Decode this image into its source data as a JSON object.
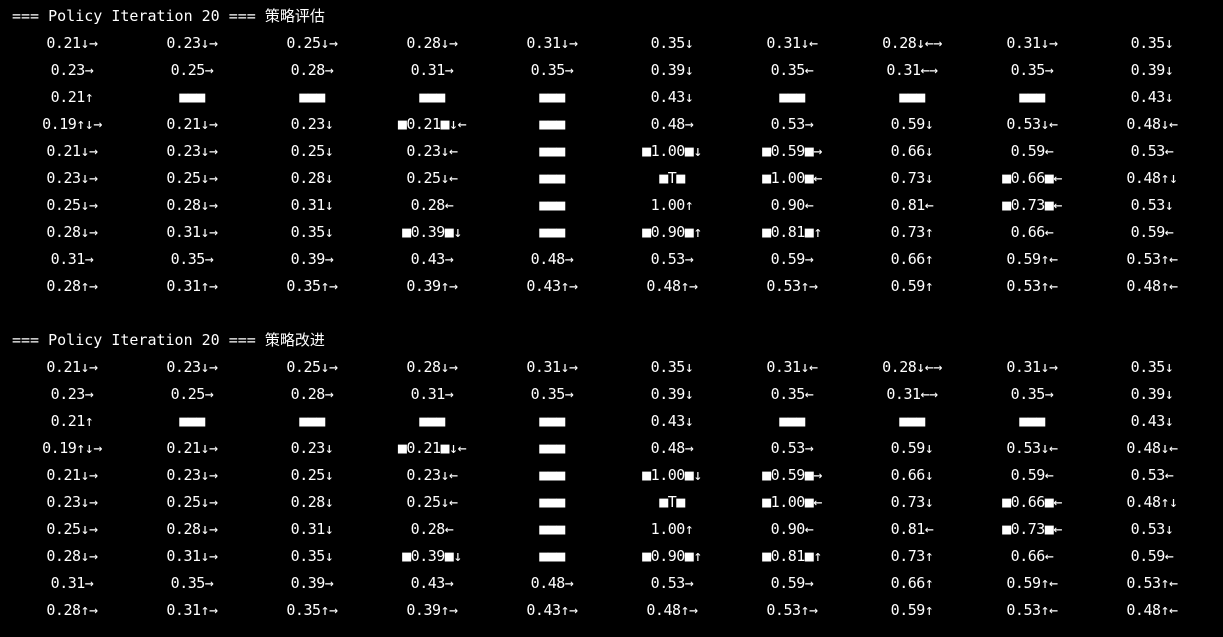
{
  "colors": {
    "background": "#000000",
    "foreground": "#ffffff"
  },
  "sections": [
    {
      "title": "=== Policy Iteration 20 === 策略评估",
      "rows": [
        [
          "0.21↓→",
          "0.23↓→",
          "0.25↓→",
          "0.28↓→",
          "0.31↓→",
          "0.35↓",
          "0.31↓←",
          "0.28↓←→",
          "0.31↓→",
          "0.35↓"
        ],
        [
          "0.23→",
          "0.25→",
          "0.28→",
          "0.31→",
          "0.35→",
          "0.39↓",
          "0.35←",
          "0.31←→",
          "0.35→",
          "0.39↓"
        ],
        [
          "0.21↑",
          "■■■",
          "■■■",
          "■■■",
          "■■■",
          "0.43↓",
          "■■■",
          "■■■",
          "■■■",
          "0.43↓"
        ],
        [
          "0.19↑↓→",
          "0.21↓→",
          "0.23↓",
          "■0.21■↓←",
          "■■■",
          "0.48→",
          "0.53→",
          "0.59↓",
          "0.53↓←",
          "0.48↓←"
        ],
        [
          "0.21↓→",
          "0.23↓→",
          "0.25↓",
          "0.23↓←",
          "■■■",
          "■1.00■↓",
          "■0.59■→",
          "0.66↓",
          "0.59←",
          "0.53←"
        ],
        [
          "0.23↓→",
          "0.25↓→",
          "0.28↓",
          "0.25↓←",
          "■■■",
          "■T■",
          "■1.00■←",
          "0.73↓",
          "■0.66■←",
          "0.48↑↓"
        ],
        [
          "0.25↓→",
          "0.28↓→",
          "0.31↓",
          "0.28←",
          "■■■",
          "1.00↑",
          "0.90←",
          "0.81←",
          "■0.73■←",
          "0.53↓"
        ],
        [
          "0.28↓→",
          "0.31↓→",
          "0.35↓",
          "■0.39■↓",
          "■■■",
          "■0.90■↑",
          "■0.81■↑",
          "0.73↑",
          "0.66←",
          "0.59←"
        ],
        [
          "0.31→",
          "0.35→",
          "0.39→",
          "0.43→",
          "0.48→",
          "0.53→",
          "0.59→",
          "0.66↑",
          "0.59↑←",
          "0.53↑←"
        ],
        [
          "0.28↑→",
          "0.31↑→",
          "0.35↑→",
          "0.39↑→",
          "0.43↑→",
          "0.48↑→",
          "0.53↑→",
          "0.59↑",
          "0.53↑←",
          "0.48↑←"
        ]
      ]
    },
    {
      "title": "=== Policy Iteration 20 === 策略改进",
      "rows": [
        [
          "0.21↓→",
          "0.23↓→",
          "0.25↓→",
          "0.28↓→",
          "0.31↓→",
          "0.35↓",
          "0.31↓←",
          "0.28↓←→",
          "0.31↓→",
          "0.35↓"
        ],
        [
          "0.23→",
          "0.25→",
          "0.28→",
          "0.31→",
          "0.35→",
          "0.39↓",
          "0.35←",
          "0.31←→",
          "0.35→",
          "0.39↓"
        ],
        [
          "0.21↑",
          "■■■",
          "■■■",
          "■■■",
          "■■■",
          "0.43↓",
          "■■■",
          "■■■",
          "■■■",
          "0.43↓"
        ],
        [
          "0.19↑↓→",
          "0.21↓→",
          "0.23↓",
          "■0.21■↓←",
          "■■■",
          "0.48→",
          "0.53→",
          "0.59↓",
          "0.53↓←",
          "0.48↓←"
        ],
        [
          "0.21↓→",
          "0.23↓→",
          "0.25↓",
          "0.23↓←",
          "■■■",
          "■1.00■↓",
          "■0.59■→",
          "0.66↓",
          "0.59←",
          "0.53←"
        ],
        [
          "0.23↓→",
          "0.25↓→",
          "0.28↓",
          "0.25↓←",
          "■■■",
          "■T■",
          "■1.00■←",
          "0.73↓",
          "■0.66■←",
          "0.48↑↓"
        ],
        [
          "0.25↓→",
          "0.28↓→",
          "0.31↓",
          "0.28←",
          "■■■",
          "1.00↑",
          "0.90←",
          "0.81←",
          "■0.73■←",
          "0.53↓"
        ],
        [
          "0.28↓→",
          "0.31↓→",
          "0.35↓",
          "■0.39■↓",
          "■■■",
          "■0.90■↑",
          "■0.81■↑",
          "0.73↑",
          "0.66←",
          "0.59←"
        ],
        [
          "0.31→",
          "0.35→",
          "0.39→",
          "0.43→",
          "0.48→",
          "0.53→",
          "0.59→",
          "0.66↑",
          "0.59↑←",
          "0.53↑←"
        ],
        [
          "0.28↑→",
          "0.31↑→",
          "0.35↑→",
          "0.39↑→",
          "0.43↑→",
          "0.48↑→",
          "0.53↑→",
          "0.59↑",
          "0.53↑←",
          "0.48↑←"
        ]
      ]
    }
  ]
}
